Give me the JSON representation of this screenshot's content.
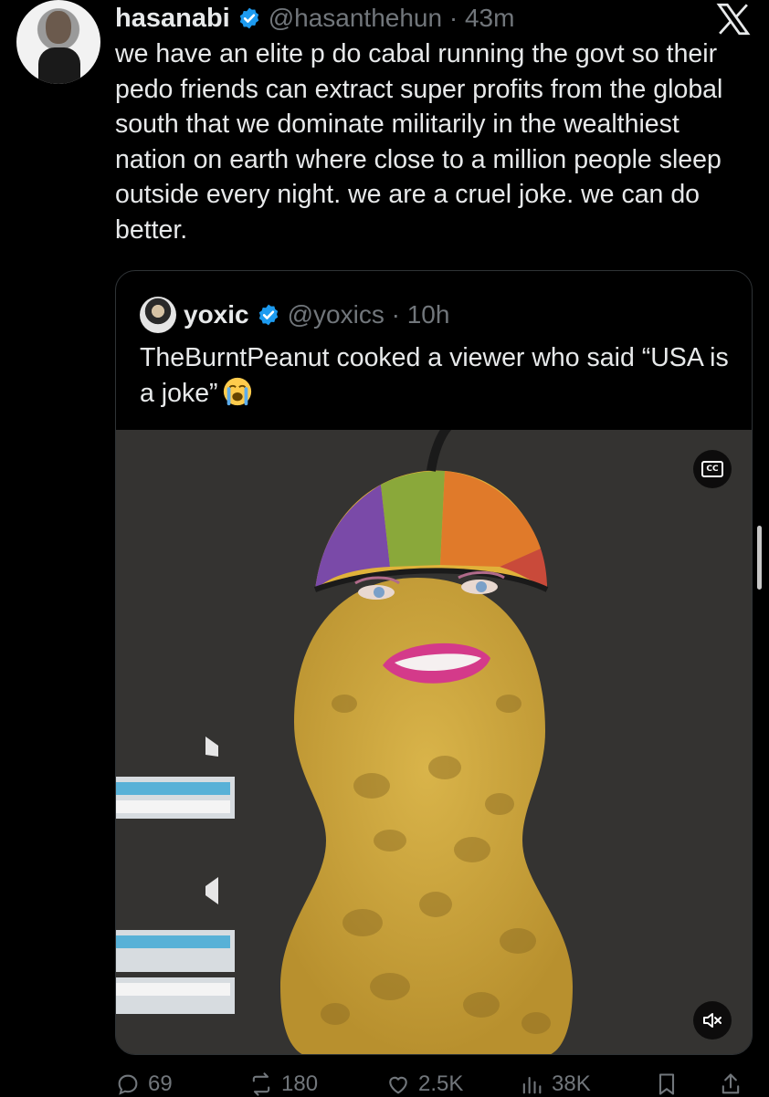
{
  "tweet": {
    "display_name": "hasanabi",
    "handle_meta": "@hasanthehun · 43m",
    "text": "we have an elite p   do cabal running the govt so their pedo friends can extract super profits from the global south that we dominate militarily in the wealthiest nation on earth where close to a million people sleep outside every night. we are a cruel joke. we can do better."
  },
  "quote": {
    "display_name": "yoxic",
    "handle_meta": "@yoxics · 10h",
    "text": "TheBurntPeanut cooked a viewer who said “USA is a joke”",
    "emoji": "loudly-crying-face",
    "media": {
      "cc_label": "CC",
      "muted": true
    }
  },
  "actions": {
    "replies": "69",
    "reposts": "180",
    "likes": "2.5K",
    "views": "38K"
  },
  "colors": {
    "background": "#000000",
    "text": "#e7e9ea",
    "muted": "#71767b",
    "verified": "#1d9bf0",
    "border": "#2f3336"
  },
  "icons": [
    "verified-badge-icon",
    "x-logo-icon",
    "cc-icon",
    "mute-icon",
    "reply-icon",
    "repost-icon",
    "like-icon",
    "views-icon",
    "bookmark-icon",
    "share-icon"
  ]
}
